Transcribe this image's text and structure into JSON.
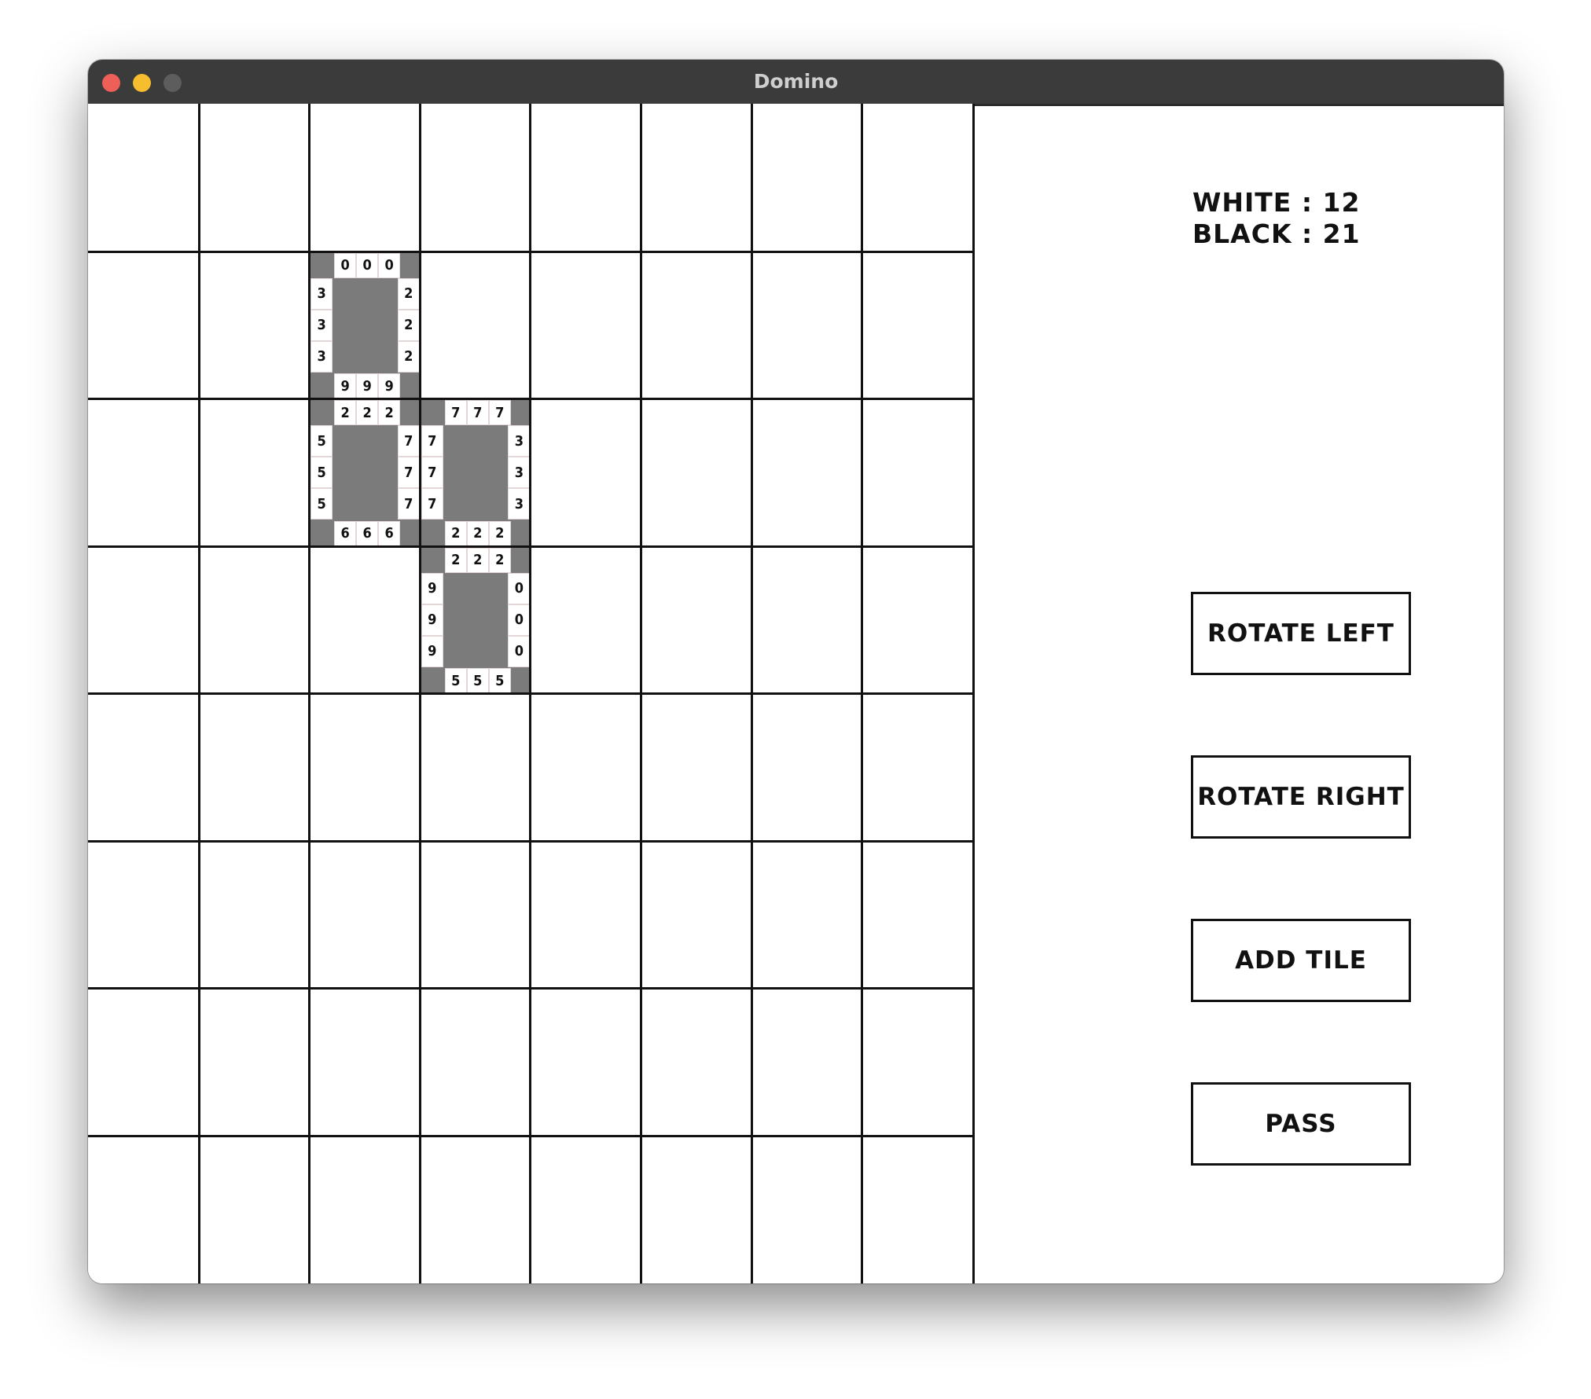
{
  "window": {
    "title": "Domino"
  },
  "scores": {
    "white": "WHITE : 12",
    "black": "BLACK : 21"
  },
  "buttons": {
    "rotate_left": "ROTATE LEFT",
    "rotate_right": "ROTATE RIGHT",
    "add_tile": "ADD TILE",
    "pass": "PASS"
  },
  "board": {
    "rows": 8,
    "cols": 8,
    "tiles": [
      {
        "row": 1,
        "col": 2,
        "top": "0",
        "right": "2",
        "bottom": "9",
        "left": "3"
      },
      {
        "row": 2,
        "col": 2,
        "top": "2",
        "right": "7",
        "bottom": "6",
        "left": "5"
      },
      {
        "row": 2,
        "col": 3,
        "top": "7",
        "right": "3",
        "bottom": "2",
        "left": "7"
      },
      {
        "row": 3,
        "col": 3,
        "top": "2",
        "right": "0",
        "bottom": "5",
        "left": "9"
      }
    ]
  }
}
